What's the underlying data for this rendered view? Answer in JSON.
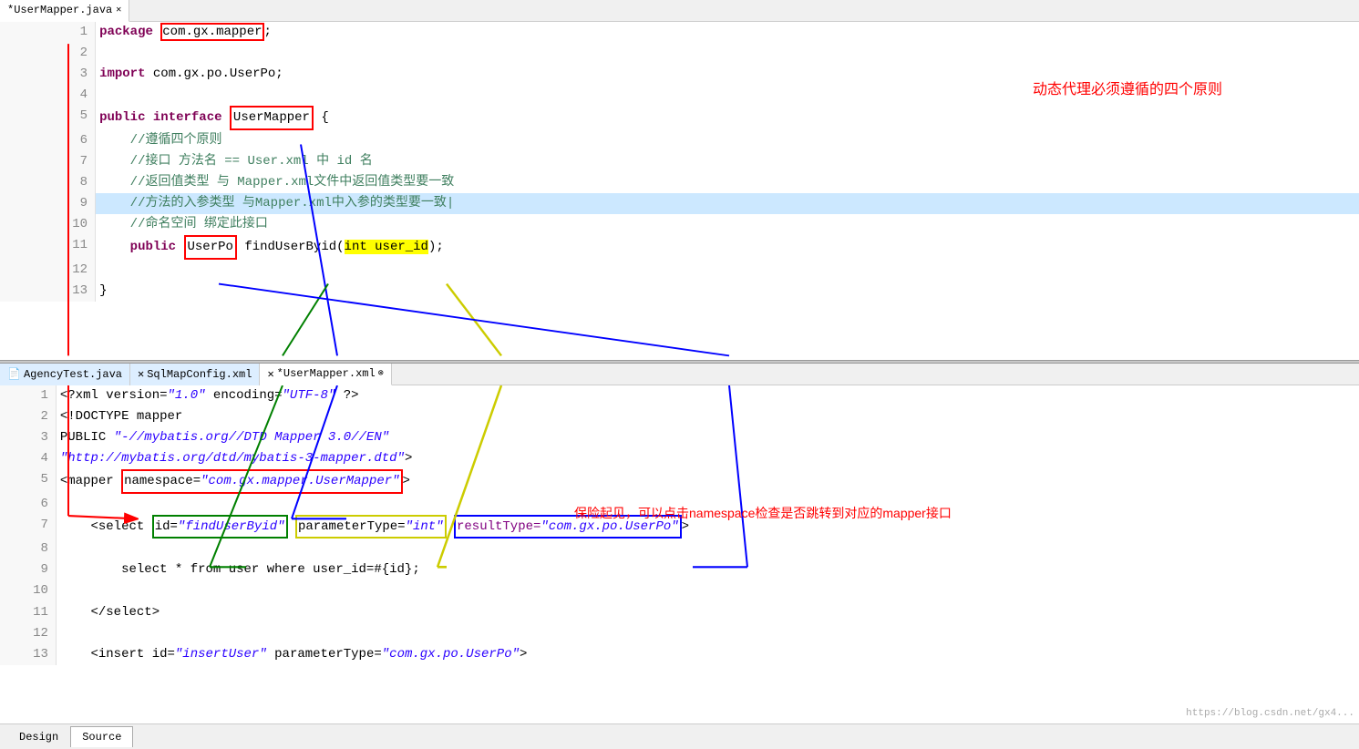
{
  "topEditor": {
    "tab": {
      "label": "*UserMapper.java",
      "closeable": true
    },
    "lines": [
      {
        "num": 1,
        "content": "package_kw",
        "highlight": false
      },
      {
        "num": 2,
        "content": "",
        "highlight": false
      },
      {
        "num": 3,
        "content": "import_line",
        "highlight": false
      },
      {
        "num": 4,
        "content": "",
        "highlight": false
      },
      {
        "num": 5,
        "content": "interface_line",
        "highlight": false
      },
      {
        "num": 6,
        "content": "comment1",
        "highlight": false
      },
      {
        "num": 7,
        "content": "comment2",
        "highlight": false
      },
      {
        "num": 8,
        "content": "comment3",
        "highlight": false
      },
      {
        "num": 9,
        "content": "comment4",
        "highlight": true
      },
      {
        "num": 10,
        "content": "comment5",
        "highlight": false
      },
      {
        "num": 11,
        "content": "method_line",
        "highlight": false
      },
      {
        "num": 12,
        "content": "",
        "highlight": false
      },
      {
        "num": 13,
        "content": "close_brace",
        "highlight": false
      }
    ],
    "annotation": "动态代理必须遵循的四个原则"
  },
  "bottomEditor": {
    "tabs": [
      {
        "label": "AgencyTest.java",
        "active": false,
        "closeable": false
      },
      {
        "label": "SqlMapConfig.xml",
        "active": false,
        "closeable": true
      },
      {
        "label": "*UserMapper.xml",
        "active": true,
        "closeable": true
      }
    ],
    "lines": [
      {
        "num": 1,
        "content": "xml_decl"
      },
      {
        "num": 2,
        "content": "doctype"
      },
      {
        "num": 3,
        "content": "public_line"
      },
      {
        "num": 4,
        "content": "dtd_url"
      },
      {
        "num": 5,
        "content": "mapper_open"
      },
      {
        "num": 6,
        "content": ""
      },
      {
        "num": 7,
        "content": "select_open"
      },
      {
        "num": 8,
        "content": ""
      },
      {
        "num": 9,
        "content": "select_body"
      },
      {
        "num": 10,
        "content": ""
      },
      {
        "num": 11,
        "content": "select_close"
      },
      {
        "num": 12,
        "content": ""
      },
      {
        "num": 13,
        "content": "insert_line"
      }
    ],
    "annotation": "保险起见，可以点击namespace检查是否跳转到对应的mapper接口"
  },
  "statusBar": {
    "tabs": [
      "Design",
      "Source"
    ]
  },
  "watermark": "https://blog.csdn.net/gx4"
}
